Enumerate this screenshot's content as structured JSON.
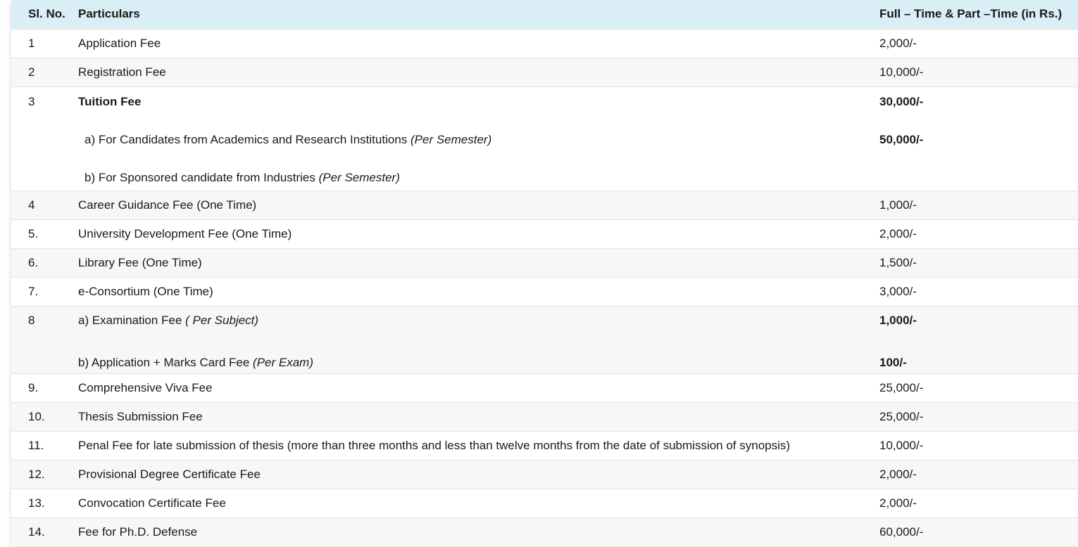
{
  "table": {
    "headers": {
      "sl": "Sl. No.",
      "particulars": "Particulars",
      "amount": "Full – Time & Part –Time (in Rs.)"
    },
    "rows": [
      {
        "sl": "1",
        "particulars": "Application Fee",
        "amount": "2,000/-"
      },
      {
        "sl": "2",
        "particulars": "Registration Fee",
        "amount": "10,000/-"
      },
      {
        "sl": "3",
        "particulars": "Tuition Fee",
        "amount": "30,000/-",
        "sub_a": "a) For Candidates from Academics and Research Institutions ",
        "sub_a_note": "(Per Semester)",
        "sub_a_amount": "50,000/-",
        "sub_b": "b) For Sponsored candidate from Industries ",
        "sub_b_note": "(Per Semester)"
      },
      {
        "sl": "4",
        "particulars": "Career Guidance Fee (One Time)",
        "amount": "1,000/-"
      },
      {
        "sl": "5.",
        "particulars": "University Development Fee (One Time)",
        "amount": "2,000/-"
      },
      {
        "sl": "6.",
        "particulars": "Library Fee (One Time)",
        "amount": "1,500/-"
      },
      {
        "sl": "7.",
        "particulars": "e-Consortium (One Time)",
        "amount": "3,000/-"
      },
      {
        "sl": "8",
        "sub_a": "a) Examination Fee ",
        "sub_a_note": "( Per Subject)",
        "sub_a_amount": "1,000/-",
        "sub_b": "b) Application + Marks Card Fee ",
        "sub_b_note": "(Per Exam)",
        "sub_b_amount": "100/-"
      },
      {
        "sl": "9.",
        "particulars": "Comprehensive Viva Fee",
        "amount": "25,000/-"
      },
      {
        "sl": "10.",
        "particulars": "Thesis Submission Fee",
        "amount": "25,000/-"
      },
      {
        "sl": "11.",
        "particulars": "Penal Fee for late submission of thesis (more than three months and less than twelve months from the date of submission of synopsis)",
        "amount": "10,000/-"
      },
      {
        "sl": "12.",
        "particulars": "Provisional Degree Certificate Fee",
        "amount": "2,000/-"
      },
      {
        "sl": "13.",
        "particulars": "Convocation Certificate Fee",
        "amount": "2,000/-"
      },
      {
        "sl": "14.",
        "particulars": "Fee for Ph.D. Defense",
        "amount": "60,000/-"
      }
    ]
  }
}
